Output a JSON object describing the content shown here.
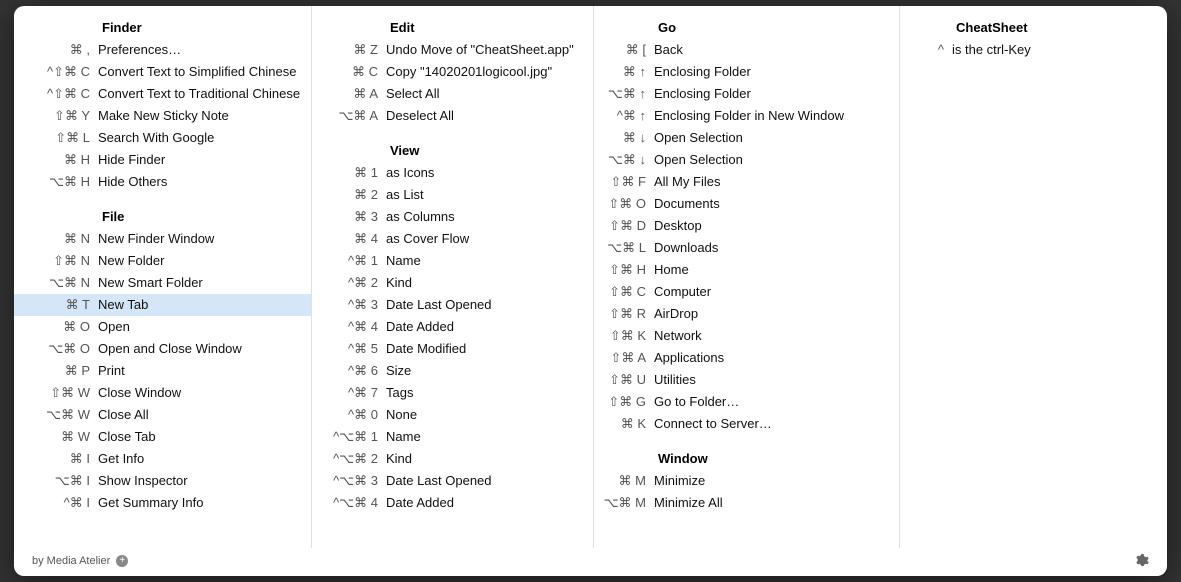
{
  "col1": {
    "sections": [
      {
        "title": "Finder",
        "items": [
          {
            "keys": "⌘ ,",
            "label": "Preferences…"
          },
          {
            "keys": "^⇧⌘ C",
            "label": "Convert Text to Simplified Chinese"
          },
          {
            "keys": "^⇧⌘ C",
            "label": "Convert Text to Traditional Chinese"
          },
          {
            "keys": "⇧⌘ Y",
            "label": "Make New Sticky Note"
          },
          {
            "keys": "⇧⌘ L",
            "label": "Search With Google"
          },
          {
            "keys": "⌘ H",
            "label": "Hide Finder"
          },
          {
            "keys": "⌥⌘ H",
            "label": "Hide Others"
          }
        ]
      },
      {
        "title": "File",
        "items": [
          {
            "keys": "⌘ N",
            "label": "New Finder Window"
          },
          {
            "keys": "⇧⌘ N",
            "label": "New Folder"
          },
          {
            "keys": "⌥⌘ N",
            "label": "New Smart Folder"
          },
          {
            "keys": "⌘ T",
            "label": "New Tab",
            "highlight": true
          },
          {
            "keys": "⌘ O",
            "label": "Open"
          },
          {
            "keys": "⌥⌘ O",
            "label": "Open and Close Window"
          },
          {
            "keys": "⌘ P",
            "label": "Print"
          },
          {
            "keys": "⇧⌘ W",
            "label": "Close Window"
          },
          {
            "keys": "⌥⌘ W",
            "label": "Close All"
          },
          {
            "keys": "⌘ W",
            "label": "Close Tab"
          },
          {
            "keys": "⌘ I",
            "label": "Get Info"
          },
          {
            "keys": "⌥⌘ I",
            "label": "Show Inspector"
          },
          {
            "keys": "^⌘ I",
            "label": "Get Summary Info"
          }
        ]
      }
    ]
  },
  "col2": {
    "sections": [
      {
        "title": "Edit",
        "items": [
          {
            "keys": "⌘ Z",
            "label": "Undo Move of \"CheatSheet.app\""
          },
          {
            "keys": "⌘ C",
            "label": "Copy \"14020201logicool.jpg\""
          },
          {
            "keys": "⌘ A",
            "label": "Select All"
          },
          {
            "keys": "⌥⌘ A",
            "label": "Deselect All"
          }
        ]
      },
      {
        "title": "View",
        "items": [
          {
            "keys": "⌘ 1",
            "label": "as Icons"
          },
          {
            "keys": "⌘ 2",
            "label": "as List"
          },
          {
            "keys": "⌘ 3",
            "label": "as Columns"
          },
          {
            "keys": "⌘ 4",
            "label": "as Cover Flow"
          },
          {
            "keys": "^⌘ 1",
            "label": "Name"
          },
          {
            "keys": "^⌘ 2",
            "label": "Kind"
          },
          {
            "keys": "^⌘ 3",
            "label": "Date Last Opened"
          },
          {
            "keys": "^⌘ 4",
            "label": "Date Added"
          },
          {
            "keys": "^⌘ 5",
            "label": "Date Modified"
          },
          {
            "keys": "^⌘ 6",
            "label": "Size"
          },
          {
            "keys": "^⌘ 7",
            "label": "Tags"
          },
          {
            "keys": "^⌘ 0",
            "label": "None"
          },
          {
            "keys": "^⌥⌘ 1",
            "label": "Name"
          },
          {
            "keys": "^⌥⌘ 2",
            "label": "Kind"
          },
          {
            "keys": "^⌥⌘ 3",
            "label": "Date Last Opened"
          },
          {
            "keys": "^⌥⌘ 4",
            "label": "Date Added"
          }
        ]
      }
    ]
  },
  "col3": {
    "sections": [
      {
        "title": "Go",
        "items": [
          {
            "keys": "⌘ [",
            "label": "Back"
          },
          {
            "keys": "⌘ ↑",
            "label": "Enclosing Folder"
          },
          {
            "keys": "⌥⌘ ↑",
            "label": "Enclosing Folder"
          },
          {
            "keys": "^⌘ ↑",
            "label": "Enclosing Folder in New Window"
          },
          {
            "keys": "⌘ ↓",
            "label": "Open Selection"
          },
          {
            "keys": "⌥⌘ ↓",
            "label": "Open Selection"
          },
          {
            "keys": "⇧⌘ F",
            "label": "All My Files"
          },
          {
            "keys": "⇧⌘ O",
            "label": "Documents"
          },
          {
            "keys": "⇧⌘ D",
            "label": "Desktop"
          },
          {
            "keys": "⌥⌘ L",
            "label": "Downloads"
          },
          {
            "keys": "⇧⌘ H",
            "label": "Home"
          },
          {
            "keys": "⇧⌘ C",
            "label": "Computer"
          },
          {
            "keys": "⇧⌘ R",
            "label": "AirDrop"
          },
          {
            "keys": "⇧⌘ K",
            "label": "Network"
          },
          {
            "keys": "⇧⌘ A",
            "label": "Applications"
          },
          {
            "keys": "⇧⌘ U",
            "label": "Utilities"
          },
          {
            "keys": "⇧⌘ G",
            "label": "Go to Folder…"
          },
          {
            "keys": "⌘ K",
            "label": "Connect to Server…"
          }
        ]
      },
      {
        "title": "Window",
        "items": [
          {
            "keys": "⌘ M",
            "label": "Minimize"
          },
          {
            "keys": "⌥⌘ M",
            "label": "Minimize All"
          }
        ]
      }
    ]
  },
  "col4": {
    "sections": [
      {
        "title": "CheatSheet",
        "items": [
          {
            "keys": "^",
            "label": "is the ctrl-Key"
          }
        ]
      }
    ]
  },
  "footer": {
    "credit": "by Media Atelier"
  }
}
